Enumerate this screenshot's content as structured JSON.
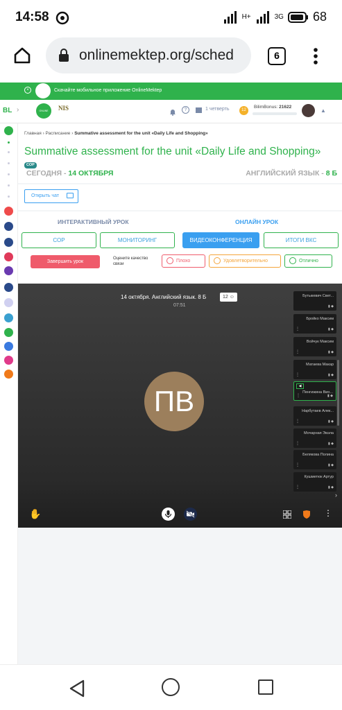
{
  "status_bar": {
    "time": "14:58",
    "network": "H+",
    "network2": "3G",
    "battery": "68"
  },
  "browser": {
    "url": "onlinemektep.org/sched",
    "tab_count": "6"
  },
  "banner": {
    "text": "Скачайте мобильное приложение OnlineMektep"
  },
  "header": {
    "brand_abbr": "BL",
    "logo_text": "ONLINE MEKTEP",
    "nis_text": "NIS",
    "quarter": "1 четверть",
    "bonus_label": "BilimBonus: ",
    "bonus_value": "21622",
    "bonus_badge": "12"
  },
  "breadcrumb": {
    "home": "Главная",
    "schedule": "Расписание",
    "current": "Summative assessment for the unit «Daily Life and Shopping»"
  },
  "page": {
    "title": "Summative assessment for the unit «Daily Life and Shopping»",
    "badge": "СОР",
    "date_prefix": "СЕГОДНЯ - ",
    "date": "14 ОКТЯБРЯ",
    "subject_prefix": "АНГЛИЙСКИЙ ЯЗЫК - ",
    "class": "8 Б",
    "open_chat": "Открыть чат"
  },
  "lesson_tabs": {
    "interactive": "ИНТЕРАКТИВНЫЙ УРОК",
    "online": "ОНЛАЙН УРОК"
  },
  "subtabs": [
    "СОР",
    "МОНИТОРИНГ",
    "ВИДЕОКОНФЕРЕНЦИЯ",
    "ИТОГИ ВКС"
  ],
  "controls": {
    "end_lesson": "Завершить урок",
    "rate_label": "Оцените качество связи",
    "rate_bad": "Плохо",
    "rate_ok": "Удовлетворительно",
    "rate_good": "Отлично"
  },
  "video": {
    "title": "14 октября. Английский язык. 8 Б",
    "count": "12",
    "timer": "07:51",
    "avatar_initials": "ПВ",
    "avatar_color": "#9c7f5c",
    "participants": [
      "Бутыкевич Свет...",
      "Бройко Максим",
      "Войчук Максим",
      "Матаева Макар",
      "Пенгижина Вио...",
      "Нарбутаев Алек...",
      "Мочарная Эвэла",
      "Белякова Полина",
      "Кушметюк Артур"
    ]
  },
  "colors": {
    "green": "#2fb24c",
    "blue": "#3a9ff0",
    "red": "#ef5b6b"
  }
}
